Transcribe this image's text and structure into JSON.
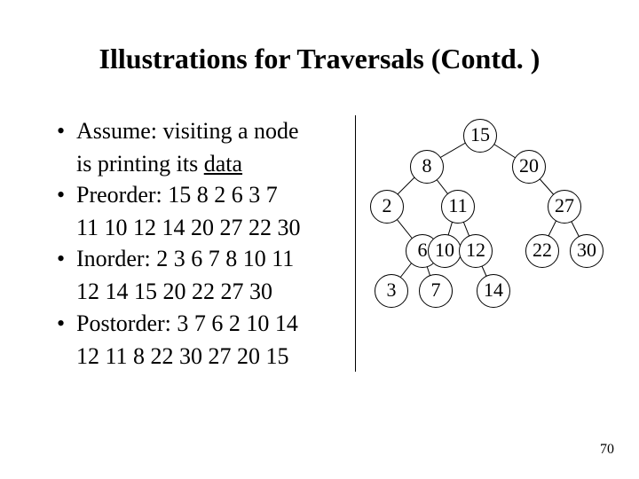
{
  "title": "Illustrations for Traversals (Contd. )",
  "bullets": [
    {
      "lead": "Assume: visiting a node",
      "cont1": "is printing its ",
      "underline": "data"
    },
    {
      "lead": "Preorder: 15 8 2 6 3 7",
      "cont1": "11 10 12 14 20 27 22 30"
    },
    {
      "lead": "Inorder: 2 3 6 7 8 10 11",
      "cont1": "12 14 15 20 22 27 30"
    },
    {
      "lead": "Postorder: 3 7 6 2 10 14",
      "cont1": "12 11 8 22 30 27 20 15"
    }
  ],
  "tree": {
    "nodes": {
      "n15": "15",
      "n8": "8",
      "n20": "20",
      "n2": "2",
      "n11": "11",
      "n27": "27",
      "n6": "6",
      "n10": "10",
      "n12": "12",
      "n22": "22",
      "n30": "30",
      "n3": "3",
      "n7": "7",
      "n14": "14"
    }
  },
  "page_number": "70"
}
